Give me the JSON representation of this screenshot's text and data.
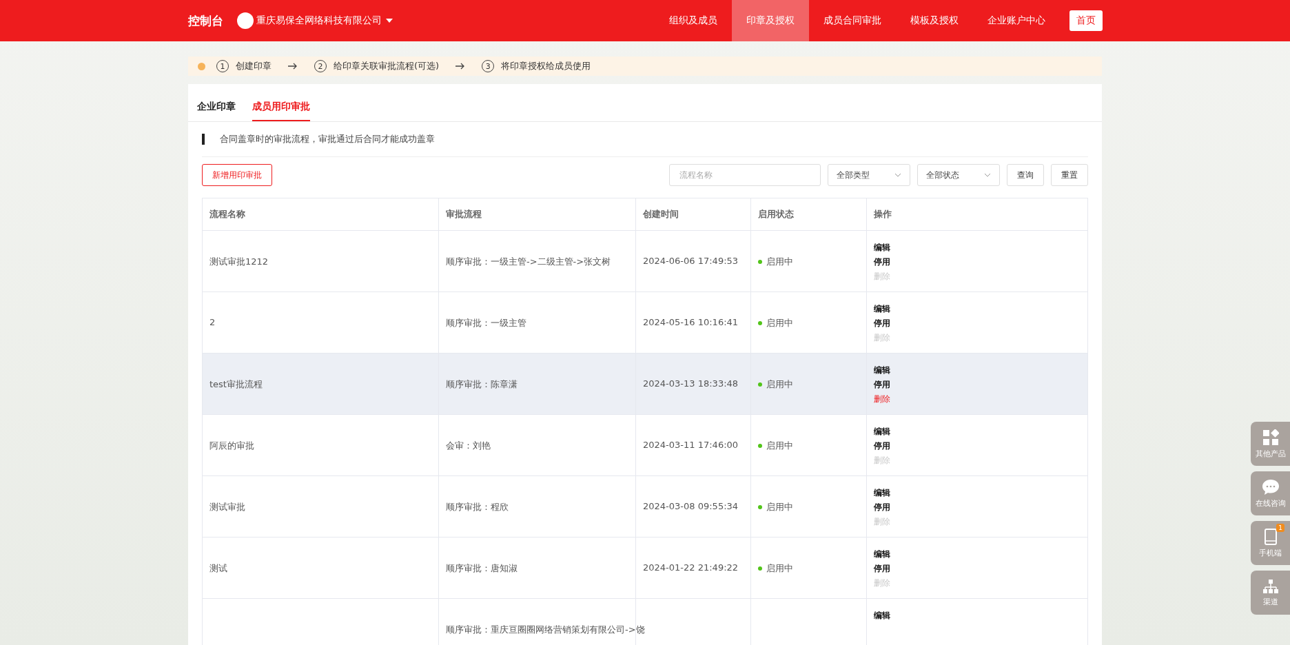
{
  "header": {
    "title": "控制台",
    "company": "重庆易保全网络科技有限公司",
    "nav": [
      {
        "label": "组织及成员",
        "selected": false
      },
      {
        "label": "印章及授权",
        "selected": true
      },
      {
        "label": "成员合同审批",
        "selected": false
      },
      {
        "label": "模板及授权",
        "selected": false
      },
      {
        "label": "企业账户中心",
        "selected": false
      }
    ],
    "home": "首页"
  },
  "steps": [
    {
      "number": "1",
      "label": "创建印章"
    },
    {
      "number": "2",
      "label": "给印章关联审批流程(可选)"
    },
    {
      "number": "3",
      "label": "将印章授权给成员使用"
    }
  ],
  "tabs": [
    {
      "label": "企业印章",
      "selected": false
    },
    {
      "label": "成员用印审批",
      "selected": true
    }
  ],
  "notice": "合同盖章时的审批流程，审批通过后合同才能成功盖章",
  "toolbar": {
    "add_button": "新增用印审批",
    "search": {
      "placeholder": "流程名称"
    },
    "type_select": "全部类型",
    "status_select": "全部状态",
    "query_button": "查询",
    "reset_button": "重置"
  },
  "table": {
    "columns": [
      "流程名称",
      "审批流程",
      "创建时间",
      "启用状态",
      "操作"
    ],
    "rows": [
      {
        "name": "测试审批1212",
        "flow": "顺序审批：一级主管->二级主管->张文树",
        "created": "2024-06-06 17:49:53",
        "status": "启用中",
        "highlighted": false,
        "actions": [
          {
            "label": "编辑",
            "disabled": false
          },
          {
            "label": "停用",
            "disabled": false
          },
          {
            "label": "删除",
            "disabled": true
          }
        ]
      },
      {
        "name": "2",
        "flow": "顺序审批：一级主管",
        "created": "2024-05-16 10:16:41",
        "status": "启用中",
        "highlighted": false,
        "actions": [
          {
            "label": "编辑",
            "disabled": false
          },
          {
            "label": "停用",
            "disabled": false
          },
          {
            "label": "删除",
            "disabled": true
          }
        ]
      },
      {
        "name": "test审批流程",
        "flow": "顺序审批：陈章潇",
        "created": "2024-03-13 18:33:48",
        "status": "启用中",
        "highlighted": true,
        "actions": [
          {
            "label": "编辑",
            "disabled": false
          },
          {
            "label": "停用",
            "disabled": false
          },
          {
            "label": "删除",
            "disabled": false
          }
        ]
      },
      {
        "name": "阿辰的审批",
        "flow": "会审：刘艳",
        "created": "2024-03-11 17:46:00",
        "status": "启用中",
        "highlighted": false,
        "actions": [
          {
            "label": "编辑",
            "disabled": false
          },
          {
            "label": "停用",
            "disabled": false
          },
          {
            "label": "删除",
            "disabled": true
          }
        ]
      },
      {
        "name": "测试审批",
        "flow": "顺序审批：程欣",
        "created": "2024-03-08 09:55:34",
        "status": "启用中",
        "highlighted": false,
        "actions": [
          {
            "label": "编辑",
            "disabled": false
          },
          {
            "label": "停用",
            "disabled": false
          },
          {
            "label": "删除",
            "disabled": true
          }
        ]
      },
      {
        "name": "测试",
        "flow": "顺序审批：唐知淑",
        "created": "2024-01-22 21:49:22",
        "status": "启用中",
        "highlighted": false,
        "actions": [
          {
            "label": "编辑",
            "disabled": false
          },
          {
            "label": "停用",
            "disabled": false
          },
          {
            "label": "删除",
            "disabled": true
          }
        ]
      },
      {
        "name": "",
        "flow": "顺序审批：重庆亘圈圈网络营销策划有限公司->饶",
        "created": "",
        "status": "",
        "highlighted": false,
        "actions": [
          {
            "label": "编辑",
            "disabled": false
          }
        ]
      }
    ]
  },
  "side_tools": [
    {
      "kind": "products",
      "label": "其他产品"
    },
    {
      "kind": "chat",
      "label": "在线咨询"
    },
    {
      "kind": "mobile",
      "label": "手机端",
      "badge": "1"
    },
    {
      "kind": "channel",
      "label": "渠道"
    }
  ]
}
